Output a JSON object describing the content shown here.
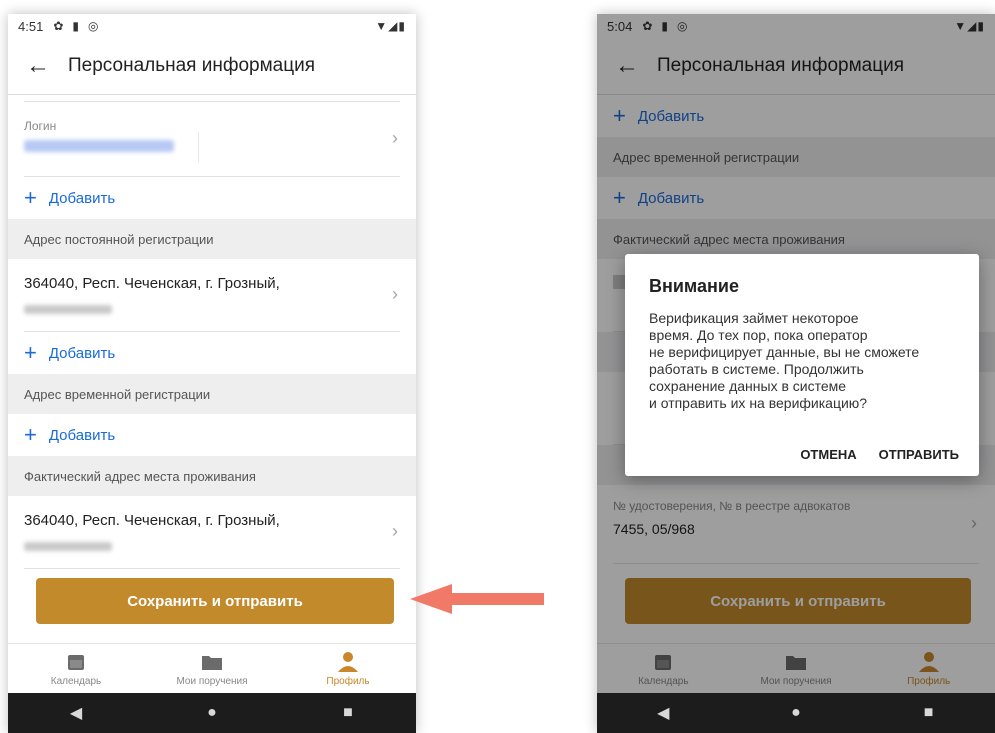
{
  "left": {
    "status": {
      "time": "4:51"
    },
    "title": "Персональная информация",
    "login_label": "Логин",
    "add_label": "Добавить",
    "sections": {
      "permanent": "Адрес постоянной регистрации",
      "temporary": "Адрес временной регистрации",
      "actual": "Фактический адрес места проживания"
    },
    "address_line": "364040, Респ. Чеченская, г. Грозный,",
    "save_button": "Сохранить и отправить",
    "nav": [
      "Календарь",
      "Мои поручения",
      "Профиль"
    ]
  },
  "right": {
    "status": {
      "time": "5:04"
    },
    "title": "Персональная информация",
    "add_label": "Добавить",
    "sections": {
      "temporary": "Адрес временной регистрации",
      "actual": "Фактический адрес места проживания"
    },
    "id_label": "№ удостоверения, № в реестре адвокатов",
    "id_value": "7455, 05/968",
    "save_button": "Сохранить и отправить",
    "nav": [
      "Календарь",
      "Мои поручения",
      "Профиль"
    ],
    "dialog": {
      "title": "Внимание",
      "lines": [
        "Верификация займет некоторое",
        "время. До тех пор, пока оператор",
        "не верифицирует данные, вы не сможете",
        "работать в системе. Продолжить",
        "сохранение данных в системе",
        "и отправить их на верификацию?"
      ],
      "cancel": "ОТМЕНА",
      "submit": "ОТПРАВИТЬ"
    }
  },
  "colors": {
    "accent": "#c28a2a",
    "link": "#1a6bd8",
    "arrow": "#f07a67"
  }
}
